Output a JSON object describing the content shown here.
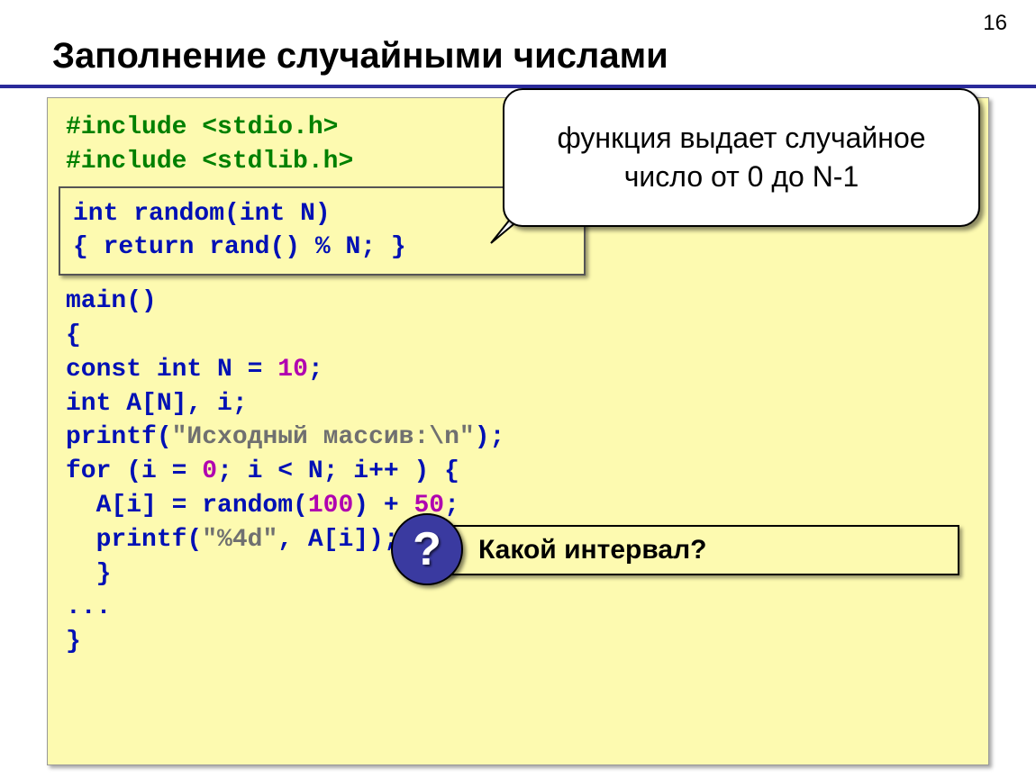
{
  "page_number": "16",
  "title": "Заполнение случайными числами",
  "callout": "функция выдает случайное число от 0 до N-1",
  "question": "Какой интервал?",
  "code": {
    "inc1a": "#include ",
    "inc1b": "<stdio.h>",
    "inc2a": "#include ",
    "inc2b": "<stdlib.h>",
    "fn1a": "int",
    "fn1b": " random(",
    "fn1c": "int",
    "fn1d": " N)",
    "fn2a": "{ ",
    "fn2b": "return",
    "fn2c": " rand() % N; }",
    "main": "main()",
    "brace_open": "{",
    "const1a": "const",
    "const1b": " ",
    "const1c": "int",
    "const1d": " N = ",
    "const1e": "10",
    "const1f": ";",
    "decl1a": "int",
    "decl1b": " A[N], i;",
    "printf1a": "printf(",
    "printf1b": "\"Исходный массив:\\n\"",
    "printf1c": ");",
    "for1a": "for",
    "for1b": " (i = ",
    "for1c": "0",
    "for1d": "; i < N; i++ ) {",
    "asg1a": "  A[i] = random(",
    "asg1b": "100",
    "asg1c": ") + ",
    "asg1d": "50",
    "asg1e": ";",
    "printf2a": "  printf(",
    "printf2b": "\"%4d\"",
    "printf2c": ", A[i]);",
    "brace_close_inner": "  }",
    "ellipsis": "...",
    "brace_close": "}"
  }
}
